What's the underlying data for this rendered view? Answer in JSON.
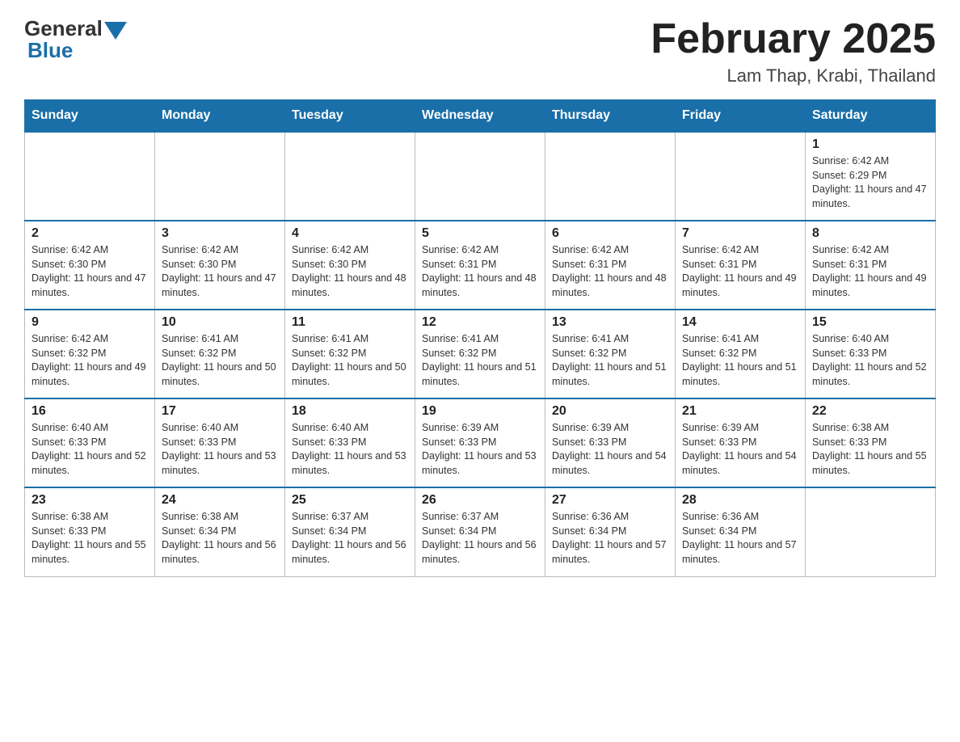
{
  "header": {
    "logo_general": "General",
    "logo_blue": "Blue",
    "month_title": "February 2025",
    "location": "Lam Thap, Krabi, Thailand"
  },
  "weekdays": [
    "Sunday",
    "Monday",
    "Tuesday",
    "Wednesday",
    "Thursday",
    "Friday",
    "Saturday"
  ],
  "weeks": [
    [
      {
        "day": "",
        "info": ""
      },
      {
        "day": "",
        "info": ""
      },
      {
        "day": "",
        "info": ""
      },
      {
        "day": "",
        "info": ""
      },
      {
        "day": "",
        "info": ""
      },
      {
        "day": "",
        "info": ""
      },
      {
        "day": "1",
        "info": "Sunrise: 6:42 AM\nSunset: 6:29 PM\nDaylight: 11 hours and 47 minutes."
      }
    ],
    [
      {
        "day": "2",
        "info": "Sunrise: 6:42 AM\nSunset: 6:30 PM\nDaylight: 11 hours and 47 minutes."
      },
      {
        "day": "3",
        "info": "Sunrise: 6:42 AM\nSunset: 6:30 PM\nDaylight: 11 hours and 47 minutes."
      },
      {
        "day": "4",
        "info": "Sunrise: 6:42 AM\nSunset: 6:30 PM\nDaylight: 11 hours and 48 minutes."
      },
      {
        "day": "5",
        "info": "Sunrise: 6:42 AM\nSunset: 6:31 PM\nDaylight: 11 hours and 48 minutes."
      },
      {
        "day": "6",
        "info": "Sunrise: 6:42 AM\nSunset: 6:31 PM\nDaylight: 11 hours and 48 minutes."
      },
      {
        "day": "7",
        "info": "Sunrise: 6:42 AM\nSunset: 6:31 PM\nDaylight: 11 hours and 49 minutes."
      },
      {
        "day": "8",
        "info": "Sunrise: 6:42 AM\nSunset: 6:31 PM\nDaylight: 11 hours and 49 minutes."
      }
    ],
    [
      {
        "day": "9",
        "info": "Sunrise: 6:42 AM\nSunset: 6:32 PM\nDaylight: 11 hours and 49 minutes."
      },
      {
        "day": "10",
        "info": "Sunrise: 6:41 AM\nSunset: 6:32 PM\nDaylight: 11 hours and 50 minutes."
      },
      {
        "day": "11",
        "info": "Sunrise: 6:41 AM\nSunset: 6:32 PM\nDaylight: 11 hours and 50 minutes."
      },
      {
        "day": "12",
        "info": "Sunrise: 6:41 AM\nSunset: 6:32 PM\nDaylight: 11 hours and 51 minutes."
      },
      {
        "day": "13",
        "info": "Sunrise: 6:41 AM\nSunset: 6:32 PM\nDaylight: 11 hours and 51 minutes."
      },
      {
        "day": "14",
        "info": "Sunrise: 6:41 AM\nSunset: 6:32 PM\nDaylight: 11 hours and 51 minutes."
      },
      {
        "day": "15",
        "info": "Sunrise: 6:40 AM\nSunset: 6:33 PM\nDaylight: 11 hours and 52 minutes."
      }
    ],
    [
      {
        "day": "16",
        "info": "Sunrise: 6:40 AM\nSunset: 6:33 PM\nDaylight: 11 hours and 52 minutes."
      },
      {
        "day": "17",
        "info": "Sunrise: 6:40 AM\nSunset: 6:33 PM\nDaylight: 11 hours and 53 minutes."
      },
      {
        "day": "18",
        "info": "Sunrise: 6:40 AM\nSunset: 6:33 PM\nDaylight: 11 hours and 53 minutes."
      },
      {
        "day": "19",
        "info": "Sunrise: 6:39 AM\nSunset: 6:33 PM\nDaylight: 11 hours and 53 minutes."
      },
      {
        "day": "20",
        "info": "Sunrise: 6:39 AM\nSunset: 6:33 PM\nDaylight: 11 hours and 54 minutes."
      },
      {
        "day": "21",
        "info": "Sunrise: 6:39 AM\nSunset: 6:33 PM\nDaylight: 11 hours and 54 minutes."
      },
      {
        "day": "22",
        "info": "Sunrise: 6:38 AM\nSunset: 6:33 PM\nDaylight: 11 hours and 55 minutes."
      }
    ],
    [
      {
        "day": "23",
        "info": "Sunrise: 6:38 AM\nSunset: 6:33 PM\nDaylight: 11 hours and 55 minutes."
      },
      {
        "day": "24",
        "info": "Sunrise: 6:38 AM\nSunset: 6:34 PM\nDaylight: 11 hours and 56 minutes."
      },
      {
        "day": "25",
        "info": "Sunrise: 6:37 AM\nSunset: 6:34 PM\nDaylight: 11 hours and 56 minutes."
      },
      {
        "day": "26",
        "info": "Sunrise: 6:37 AM\nSunset: 6:34 PM\nDaylight: 11 hours and 56 minutes."
      },
      {
        "day": "27",
        "info": "Sunrise: 6:36 AM\nSunset: 6:34 PM\nDaylight: 11 hours and 57 minutes."
      },
      {
        "day": "28",
        "info": "Sunrise: 6:36 AM\nSunset: 6:34 PM\nDaylight: 11 hours and 57 minutes."
      },
      {
        "day": "",
        "info": ""
      }
    ]
  ]
}
